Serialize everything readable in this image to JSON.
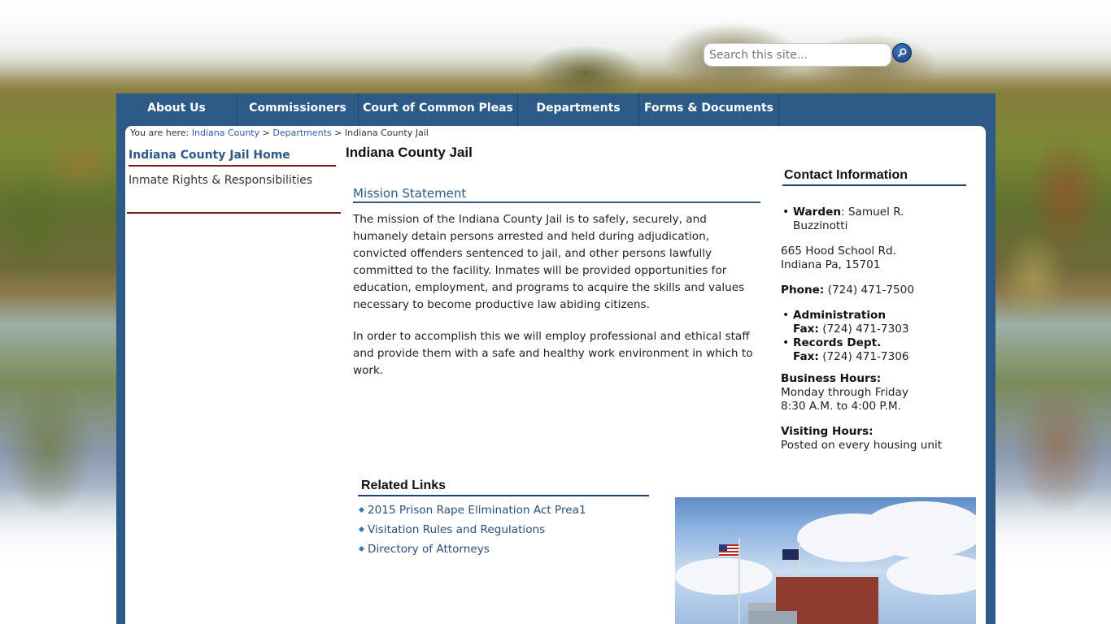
{
  "search": {
    "placeholder": "Search this site..."
  },
  "nav": {
    "items": [
      "About Us",
      "Commissioners",
      "Court of Common Pleas",
      "Departments",
      "Forms & Documents"
    ]
  },
  "breadcrumb": {
    "prefix": "You are here:",
    "links": [
      "Indiana County",
      "Departments"
    ],
    "separator": ">",
    "current": "Indiana County Jail"
  },
  "sidebar": {
    "home": "Indiana County Jail Home",
    "items": [
      "Inmate Rights & Responsibilities"
    ]
  },
  "page": {
    "title": "Indiana County Jail"
  },
  "mission": {
    "title": "Mission Statement",
    "p1": "The mission of the Indiana County Jail is to safely, securely, and humanely detain persons arrested and held during adjudication, convicted offenders sentenced to jail, and other persons lawfully committed to the facility. Inmates will be provided opportunities for education, employment, and programs to acquire the skills and values necessary to become productive law abiding citizens.",
    "p2": "In order to accomplish this we will employ professional and ethical staff and provide them with a safe and healthy work environment in which to work."
  },
  "contact": {
    "title": "Contact Information",
    "warden_label": "Warden",
    "warden_name": ": Samuel R. Buzzinotti",
    "address1": "665 Hood School Rd.",
    "address2": "Indiana Pa, 15701",
    "phone_label": "Phone:",
    "phone": "(724) 471-7500",
    "admin_label": "Administration",
    "fax_label": "Fax:",
    "admin_fax": "(724) 471-7303",
    "records_label": "Records Dept.",
    "records_fax": "(724) 471-7306",
    "business_label": "Business Hours:",
    "business_days": "Monday through Friday",
    "business_time": "8:30 A.M. to 4:00 P.M.",
    "visiting_label": "Visiting Hours:",
    "visiting_text": "Posted on every housing unit"
  },
  "related": {
    "title": "Related Links",
    "links": [
      "2015 Prison Rape Elimination Act Prea1",
      "Visitation Rules and Regulations",
      "Directory of Attorneys"
    ]
  },
  "colors": {
    "frame_blue": "#2d5a86",
    "accent_red": "#7a1c1c",
    "link_blue": "#2a5ea8"
  },
  "icons": {
    "search": "magnifier-icon",
    "bullet": "diamond-icon"
  }
}
